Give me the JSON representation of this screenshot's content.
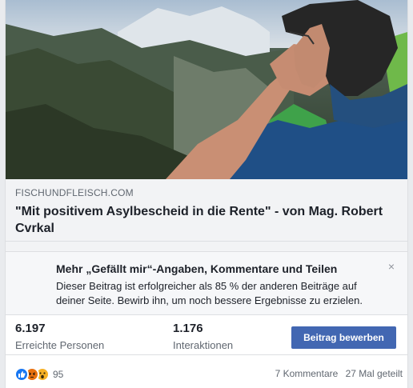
{
  "post": {
    "link": {
      "domain": "FISCHUNDFLEISCH.COM",
      "title": "\"Mit positivem Asylbescheid in die Rente\" - von Mag. Robert Cvrkal"
    },
    "tip": {
      "title": "Mehr „Gefällt mir“-Angaben, Kommentare und Teilen",
      "body": "Dieser Beitrag ist erfolgreicher als 85 % der anderen Beiträge auf deiner Seite. Bewirb ihn, um noch bessere Ergebnisse zu erzielen.",
      "close_icon": "×"
    },
    "stats": {
      "reach_value": "6.197",
      "reach_label": "Erreichte Personen",
      "interactions_value": "1.176",
      "interactions_label": "Interaktionen",
      "boost_label": "Beitrag bewerben"
    },
    "footer": {
      "reaction_icons": [
        "like-icon",
        "angry-icon",
        "wow-icon"
      ],
      "reaction_count": "95",
      "comments": "7 Kommentare",
      "shares": "27 Mal geteilt"
    },
    "colors": {
      "accent": "#4267b2",
      "like": "#1877f2",
      "angry": "#e9710f",
      "wow": "#f7b125"
    }
  }
}
